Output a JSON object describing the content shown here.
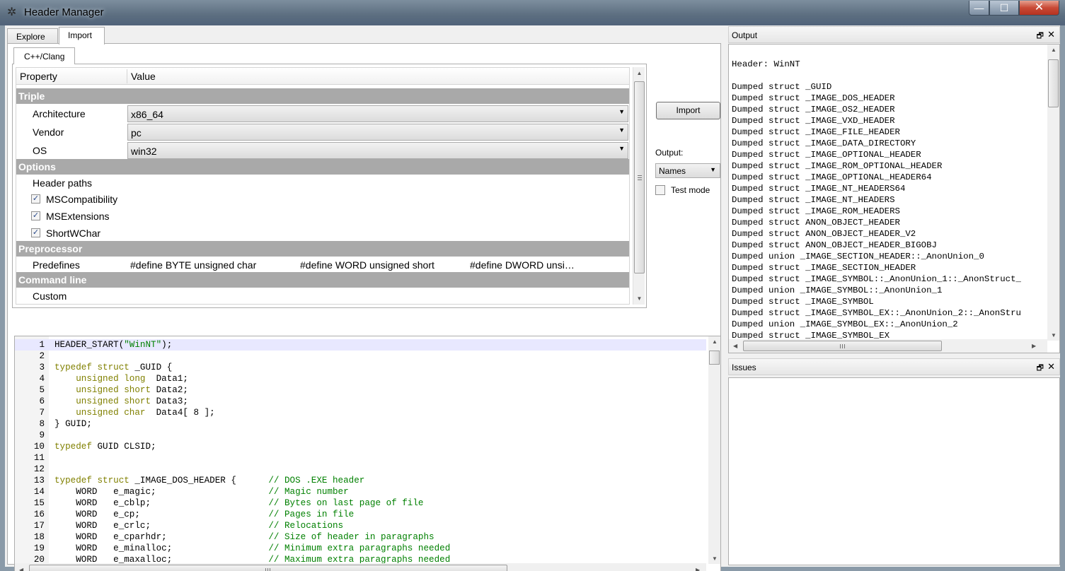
{
  "window": {
    "title": "Header Manager",
    "minimize": "—",
    "maximize": "☐",
    "close": "✕"
  },
  "tabs": [
    {
      "label": "Explore"
    },
    {
      "label": "Import"
    }
  ],
  "subtab": {
    "label": "C++/Clang"
  },
  "property_grid": {
    "columns": {
      "property": "Property",
      "value": "Value"
    },
    "groups": {
      "triple": "Triple",
      "options": "Options",
      "preprocessor": "Preprocessor",
      "command_line": "Command line"
    },
    "architecture": {
      "label": "Architecture",
      "value": "x86_64"
    },
    "vendor": {
      "label": "Vendor",
      "value": "pc"
    },
    "os": {
      "label": "OS",
      "value": "win32"
    },
    "header_paths": {
      "label": "Header paths"
    },
    "ms_compat": {
      "label": "MSCompatibility",
      "checked": "✓"
    },
    "ms_ext": {
      "label": "MSExtensions",
      "checked": "✓"
    },
    "short_wchar": {
      "label": "ShortWChar",
      "checked": "✓"
    },
    "predefines": {
      "label": "Predefines",
      "values": [
        "#define BYTE unsigned char",
        "#define WORD unsigned short",
        "#define DWORD unsi…"
      ]
    },
    "custom": {
      "label": "Custom"
    }
  },
  "controls": {
    "import_button": "Import",
    "output_label": "Output:",
    "output_select": "Names",
    "test_mode_label": "Test mode"
  },
  "code_lines": [
    {
      "n": "1",
      "parts": [
        [
          "",
          "HEADER_START("
        ],
        [
          "str",
          "\"WinNT\""
        ],
        [
          "",
          ");"
        ]
      ]
    },
    {
      "n": "2",
      "parts": []
    },
    {
      "n": "3",
      "parts": [
        [
          "kw",
          "typedef struct"
        ],
        [
          "",
          " _GUID {"
        ]
      ]
    },
    {
      "n": "4",
      "parts": [
        [
          "",
          "    "
        ],
        [
          "kw",
          "unsigned long"
        ],
        [
          "",
          "  Data1;"
        ]
      ]
    },
    {
      "n": "5",
      "parts": [
        [
          "",
          "    "
        ],
        [
          "kw",
          "unsigned short"
        ],
        [
          "",
          " Data2;"
        ]
      ]
    },
    {
      "n": "6",
      "parts": [
        [
          "",
          "    "
        ],
        [
          "kw",
          "unsigned short"
        ],
        [
          "",
          " Data3;"
        ]
      ]
    },
    {
      "n": "7",
      "parts": [
        [
          "",
          "    "
        ],
        [
          "kw",
          "unsigned char"
        ],
        [
          "",
          "  Data4[ 8 ];"
        ]
      ]
    },
    {
      "n": "8",
      "parts": [
        [
          "",
          "} GUID;"
        ]
      ]
    },
    {
      "n": "9",
      "parts": []
    },
    {
      "n": "10",
      "parts": [
        [
          "kw",
          "typedef"
        ],
        [
          "",
          " GUID CLSID;"
        ]
      ]
    },
    {
      "n": "11",
      "parts": []
    },
    {
      "n": "12",
      "parts": []
    },
    {
      "n": "13",
      "parts": [
        [
          "kw",
          "typedef struct"
        ],
        [
          "",
          " _IMAGE_DOS_HEADER {      "
        ],
        [
          "cm",
          "// DOS .EXE header"
        ]
      ]
    },
    {
      "n": "14",
      "parts": [
        [
          "",
          "    WORD   e_magic;                     "
        ],
        [
          "cm",
          "// Magic number"
        ]
      ]
    },
    {
      "n": "15",
      "parts": [
        [
          "",
          "    WORD   e_cblp;                      "
        ],
        [
          "cm",
          "// Bytes on last page of file"
        ]
      ]
    },
    {
      "n": "16",
      "parts": [
        [
          "",
          "    WORD   e_cp;                        "
        ],
        [
          "cm",
          "// Pages in file"
        ]
      ]
    },
    {
      "n": "17",
      "parts": [
        [
          "",
          "    WORD   e_crlc;                      "
        ],
        [
          "cm",
          "// Relocations"
        ]
      ]
    },
    {
      "n": "18",
      "parts": [
        [
          "",
          "    WORD   e_cparhdr;                   "
        ],
        [
          "cm",
          "// Size of header in paragraphs"
        ]
      ]
    },
    {
      "n": "19",
      "parts": [
        [
          "",
          "    WORD   e_minalloc;                  "
        ],
        [
          "cm",
          "// Minimum extra paragraphs needed"
        ]
      ]
    },
    {
      "n": "20",
      "parts": [
        [
          "",
          "    WORD   e_maxalloc;                  "
        ],
        [
          "cm",
          "// Maximum extra paragraphs needed"
        ]
      ]
    }
  ],
  "output": {
    "title": "Output",
    "lines": [
      "Header: WinNT",
      "",
      "Dumped struct _GUID",
      "Dumped struct _IMAGE_DOS_HEADER",
      "Dumped struct _IMAGE_OS2_HEADER",
      "Dumped struct _IMAGE_VXD_HEADER",
      "Dumped struct _IMAGE_FILE_HEADER",
      "Dumped struct _IMAGE_DATA_DIRECTORY",
      "Dumped struct _IMAGE_OPTIONAL_HEADER",
      "Dumped struct _IMAGE_ROM_OPTIONAL_HEADER",
      "Dumped struct _IMAGE_OPTIONAL_HEADER64",
      "Dumped struct _IMAGE_NT_HEADERS64",
      "Dumped struct _IMAGE_NT_HEADERS",
      "Dumped struct _IMAGE_ROM_HEADERS",
      "Dumped struct ANON_OBJECT_HEADER",
      "Dumped struct ANON_OBJECT_HEADER_V2",
      "Dumped struct ANON_OBJECT_HEADER_BIGOBJ",
      "Dumped union _IMAGE_SECTION_HEADER::_AnonUnion_0",
      "Dumped struct _IMAGE_SECTION_HEADER",
      "Dumped struct _IMAGE_SYMBOL::_AnonUnion_1::_AnonStruct_",
      "Dumped union _IMAGE_SYMBOL::_AnonUnion_1",
      "Dumped struct _IMAGE_SYMBOL",
      "Dumped struct _IMAGE_SYMBOL_EX::_AnonUnion_2::_AnonStru",
      "Dumped union _IMAGE_SYMBOL_EX::_AnonUnion_2",
      "Dumped struct _IMAGE_SYMBOL_EX"
    ]
  },
  "issues": {
    "title": "Issues"
  },
  "dock_icons": {
    "float": "🗗",
    "close": "✕"
  },
  "colors": {
    "group_header": "#a9a9a9",
    "keyword": "#808000",
    "comment": "#008000",
    "current_line": "#e8e8ff"
  }
}
